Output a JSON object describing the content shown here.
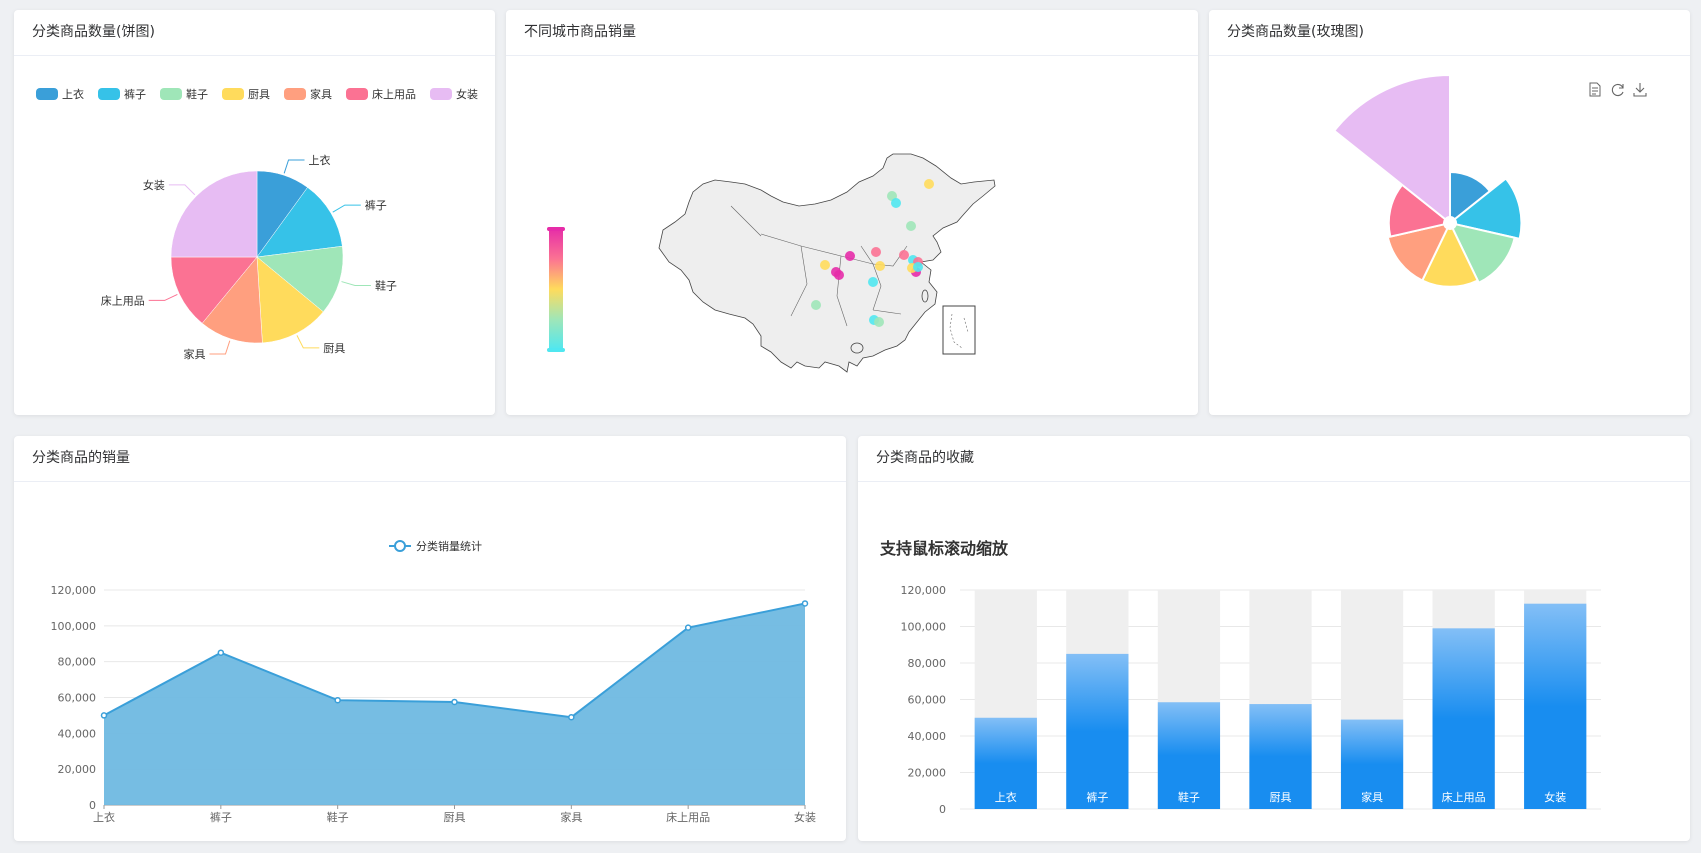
{
  "cards": {
    "pie": {
      "title": "分类商品数量(饼图)"
    },
    "map": {
      "title": "不同城市商品销量"
    },
    "rose": {
      "title": "分类商品数量(玫瑰图)"
    },
    "line": {
      "title": "分类商品的销量"
    },
    "bar": {
      "title": "分类商品的收藏",
      "subtitle": "支持鼠标滚动缩放"
    }
  },
  "colors": {
    "palette": [
      "#3a9fd9",
      "#36c2e8",
      "#9fe6b8",
      "#ffdb5c",
      "#ff9f7f",
      "#fb7293",
      "#e7bcf3"
    ],
    "line": "#3a9fd9",
    "area": "#6fb9e2",
    "bar_top": "#83bff6",
    "bar_bottom": "#188df0",
    "bar_shadow": "#efefef",
    "visualmap": [
      "#50e7f0",
      "#9fe6b8",
      "#ffdb5c",
      "#fb7293",
      "#e62ca8"
    ]
  },
  "icons": {
    "data_view": "document-icon",
    "restore": "refresh-icon",
    "save": "download-icon"
  },
  "chart_data": [
    {
      "id": "pie",
      "type": "pie",
      "title": "分类商品数量(饼图)",
      "legend": [
        "上衣",
        "裤子",
        "鞋子",
        "厨具",
        "家具",
        "床上用品",
        "女装"
      ],
      "legend_position": "top",
      "categories": [
        "上衣",
        "裤子",
        "鞋子",
        "厨具",
        "家具",
        "床上用品",
        "女装"
      ],
      "values": [
        10,
        13,
        13,
        13,
        12,
        14,
        25
      ]
    },
    {
      "id": "map",
      "type": "scatter",
      "title": "不同城市商品销量",
      "geo": "china",
      "visual_map": {
        "position": "bottom-left",
        "continuous": true
      }
    },
    {
      "id": "rose",
      "type": "pie",
      "rose": true,
      "title": "分类商品数量(玫瑰图)",
      "categories": [
        "上衣",
        "裤子",
        "鞋子",
        "厨具",
        "家具",
        "床上用品",
        "女装"
      ],
      "values": [
        20,
        28,
        26,
        25,
        25,
        24,
        58
      ],
      "toolbox": [
        "data_view",
        "restore",
        "save"
      ]
    },
    {
      "id": "line",
      "type": "area",
      "title": "分类商品的销量",
      "legend": [
        "分类销量统计"
      ],
      "legend_position": "top",
      "categories": [
        "上衣",
        "裤子",
        "鞋子",
        "厨具",
        "家具",
        "床上用品",
        "女装"
      ],
      "series": [
        {
          "name": "分类销量统计",
          "values": [
            50000,
            85000,
            58500,
            57500,
            49000,
            99000,
            112500
          ]
        }
      ],
      "ylim": [
        0,
        120000
      ],
      "yticks": [
        "0",
        "20,000",
        "40,000",
        "60,000",
        "80,000",
        "100,000",
        "120,000"
      ],
      "grid": true
    },
    {
      "id": "bar",
      "type": "bar",
      "title": "支持鼠标滚动缩放",
      "categories": [
        "上衣",
        "裤子",
        "鞋子",
        "厨具",
        "家具",
        "床上用品",
        "女装"
      ],
      "values": [
        50000,
        85000,
        58500,
        57500,
        49000,
        99000,
        112500
      ],
      "shadow_value": 120000,
      "ylim": [
        0,
        120000
      ],
      "yticks": [
        "0",
        "20,000",
        "40,000",
        "60,000",
        "80,000",
        "100,000",
        "120,000"
      ],
      "grid": true
    }
  ]
}
